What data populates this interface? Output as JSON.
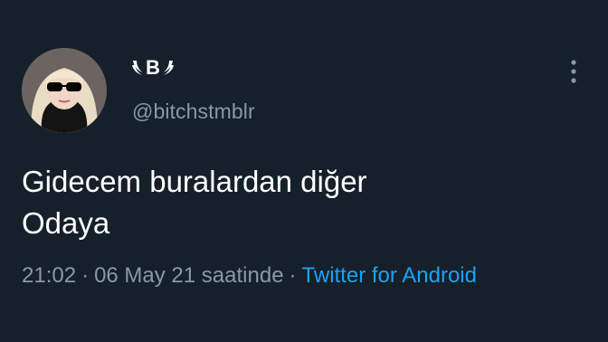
{
  "tweet": {
    "author": {
      "display_name_letter": "B",
      "handle": "@bitchstmblr",
      "avatar_icon": "profile-photo-woman-sunglasses"
    },
    "text": "Gidecem buralardan diğer\nOdaya",
    "meta": {
      "time": "21:02",
      "separator": "·",
      "date_text": "06 May 21 saatinde",
      "source": "Twitter for Android"
    },
    "more_icon": "vertical-ellipsis-icon"
  },
  "colors": {
    "background": "#15202b",
    "text": "#ffffff",
    "secondary": "#8899a6",
    "link": "#1da1f2"
  }
}
